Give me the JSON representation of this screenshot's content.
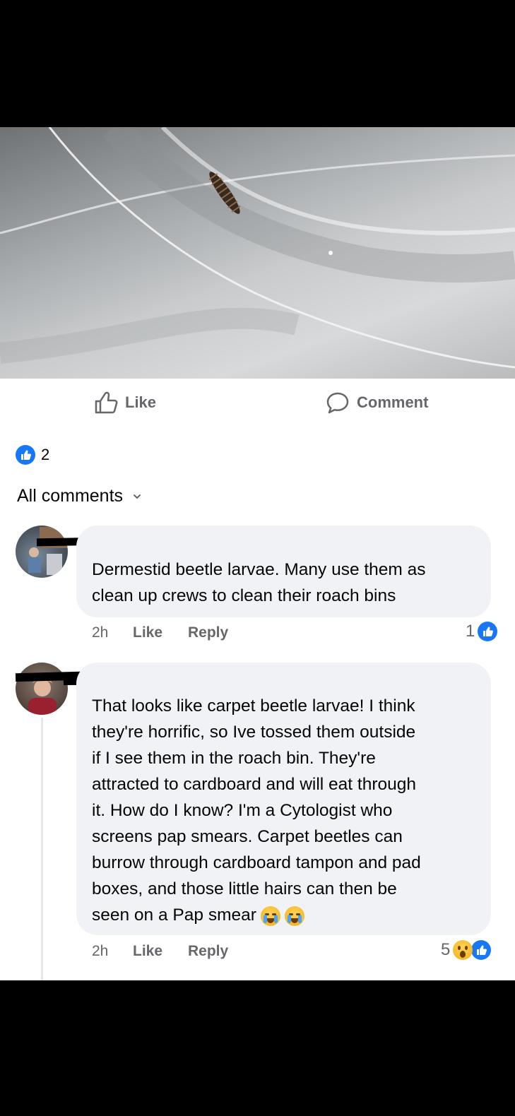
{
  "post": {
    "actions": {
      "like_label": "Like",
      "comment_label": "Comment"
    },
    "reaction_count": "2",
    "filter_label": "All comments"
  },
  "comments": [
    {
      "text_lines": [
        "Dermestid beetle larvae. Many use them as",
        "clean up crews to clean their roach bins"
      ],
      "time": "2h",
      "like_label": "Like",
      "reply_label": "Reply",
      "reaction_count": "1"
    },
    {
      "text_lines": [
        "That looks like carpet beetle larvae! I think",
        "they're horrific, so Ive tossed them outside",
        "if I see them in the roach bin. They're",
        "attracted to cardboard and will eat through",
        "it. How do I know? I'm a Cytologist who",
        "screens pap smears. Carpet beetles can",
        "burrow through cardboard tampon and pad",
        "boxes, and those little hairs can then be",
        "seen on a Pap smear"
      ],
      "time": "2h",
      "like_label": "Like",
      "reply_label": "Reply",
      "reaction_count": "5"
    }
  ],
  "colors": {
    "facebook_blue": "#1877f2",
    "bubble_gray": "#f0f2f5",
    "meta_gray": "#65676b",
    "text": "#050505"
  },
  "icons": {
    "like": "thumbs-up-icon",
    "comment": "speech-bubble-icon",
    "chevron": "chevron-down-icon",
    "crying": "loudly-crying-emoji",
    "wow": "wow-emoji"
  }
}
